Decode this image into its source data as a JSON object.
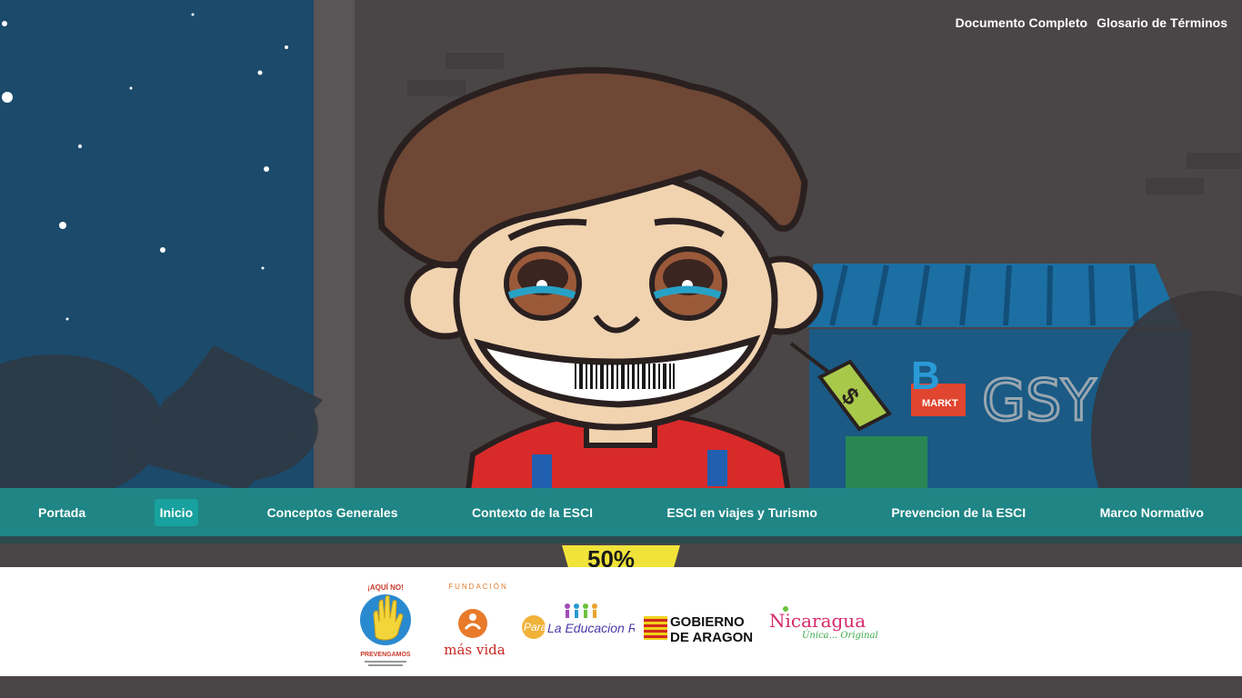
{
  "toplinks": {
    "documento": "Documento Completo",
    "glosario": "Glosario de Términos"
  },
  "nav": {
    "items": [
      {
        "label": "Portada"
      },
      {
        "label": "Inicio"
      },
      {
        "label": "Conceptos Generales"
      },
      {
        "label": "Contexto de la ESCI"
      },
      {
        "label": "ESCI en viajes y Turismo"
      },
      {
        "label": "Prevencion de la ESCI"
      },
      {
        "label": "Marco Normativo"
      }
    ],
    "active_index": 1
  },
  "hero": {
    "price_tag_symbol": "$",
    "sale_label": "50%",
    "store_sign": "B",
    "store_sign_sub": "MARKT",
    "graffiti": "GSY"
  },
  "logos": {
    "prevengamos": {
      "top": "¡AQUÍ NO!",
      "bottom": "PREVENGAMOS"
    },
    "masvida": {
      "top": "FUNDACIÓN",
      "bottom": "más vida"
    },
    "para": {
      "prefix": "Para",
      "text": "La Educacion R.L."
    },
    "aragon": {
      "line1": "GOBIERNO",
      "line2": "DE ARAGON"
    },
    "nicaragua": {
      "text": "Nicaragua",
      "tagline": "Única... Original"
    }
  },
  "colors": {
    "nav_bg": "#1f8585",
    "nav_active": "#18a19e",
    "sky": "#1b4a6b",
    "wall": "#4a4546"
  }
}
